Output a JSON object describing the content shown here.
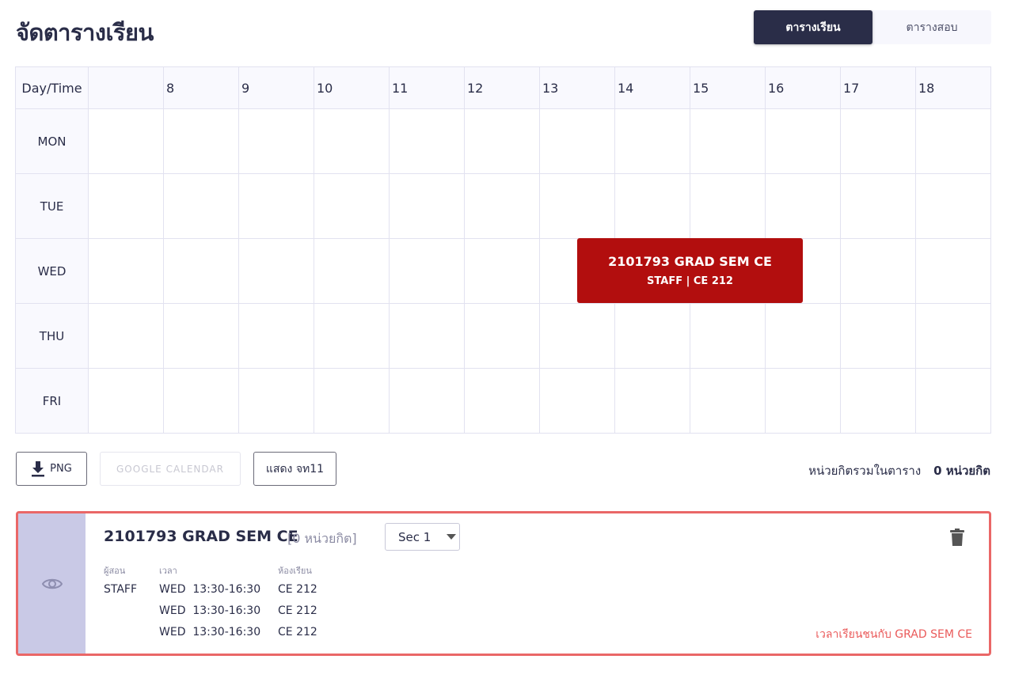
{
  "page_title": "จัดตารางเรียน",
  "view_toggle": {
    "tabs": [
      {
        "label": "ตารางเรียน",
        "active": true
      },
      {
        "label": "ตารางสอบ",
        "active": false
      }
    ]
  },
  "timetable": {
    "corner_label": "Day/Time",
    "hours": [
      "8",
      "9",
      "10",
      "11",
      "12",
      "13",
      "14",
      "15",
      "16",
      "17",
      "18"
    ],
    "days": [
      "MON",
      "TUE",
      "WED",
      "THU",
      "FRI"
    ],
    "course_block": {
      "title": "2101793 GRAD SEM CE",
      "subtitle": "STAFF | CE 212",
      "day": "WED",
      "start": "13:30",
      "end": "16:30",
      "color": "#b20e0e"
    }
  },
  "actions": {
    "png_label": "PNG",
    "gcal_label": "GOOGLE CALENDAR",
    "show_label": "แสดง จท11"
  },
  "credit_summary": {
    "label": "หน่วยกิตรวมในตาราง",
    "value": "0 หน่วยกิต"
  },
  "course_card": {
    "title": "2101793 GRAD SEM CE",
    "credit": "[0 หน่วยกิต]",
    "section": "Sec 1",
    "instructor_label": "ผู้สอน",
    "time_label": "เวลา",
    "room_label": "ห้องเรียน",
    "instructor": "STAFF",
    "times": [
      "WED  13:30-16:30",
      "WED  13:30-16:30",
      "WED  13:30-16:30"
    ],
    "rooms": [
      "CE 212",
      "CE 212",
      "CE 212"
    ],
    "conflict_text": "เวลาเรียนชนกับ GRAD SEM CE",
    "border_color": "#ea6767"
  }
}
